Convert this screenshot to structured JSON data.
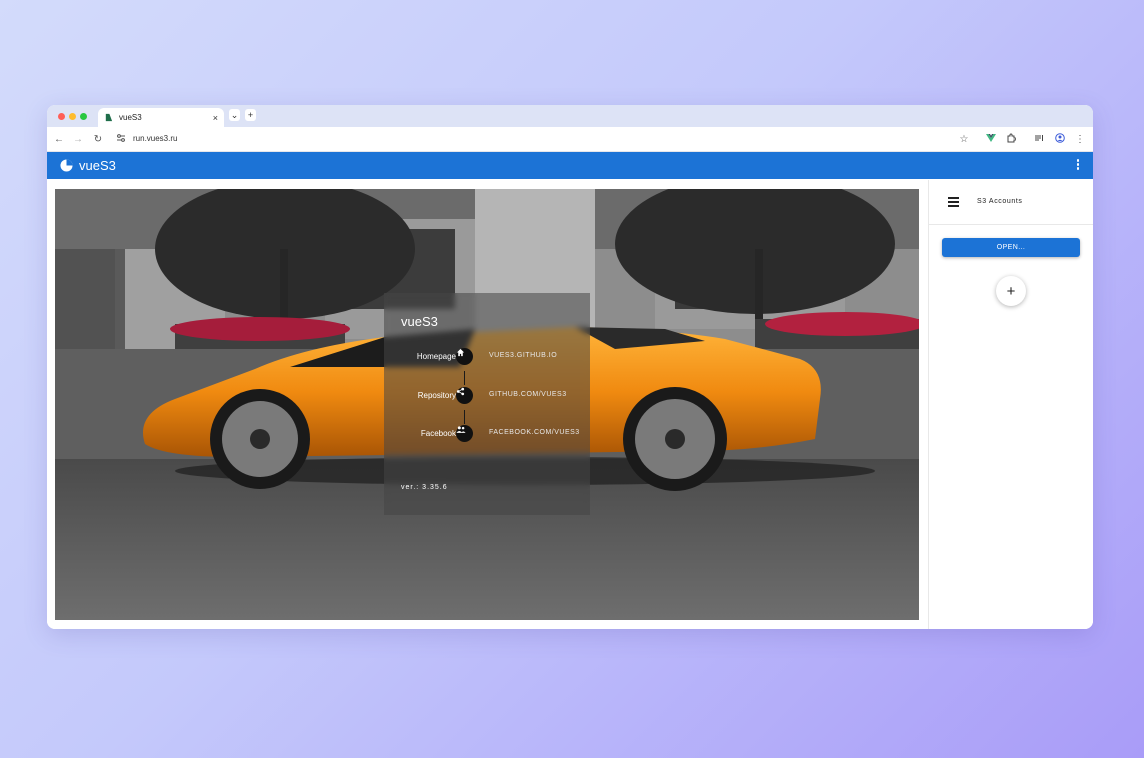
{
  "browser": {
    "tab_title": "vueS3",
    "tab_close": "×",
    "tab_list": "⌄",
    "new_tab": "+",
    "url": "run.vues3.ru"
  },
  "app": {
    "title": "vueS3",
    "brand_color": "#1c73d6"
  },
  "card": {
    "title": "vueS3",
    "links": [
      {
        "label": "Homepage",
        "link": "VUES3.GITHUB.IO",
        "icon": "home-icon"
      },
      {
        "label": "Repository",
        "link": "GITHUB.COM/VUES3",
        "icon": "share-icon"
      },
      {
        "label": "Facebook",
        "link": "FACEBOOK.COM/VUES3",
        "icon": "group-icon"
      }
    ],
    "version": "ver.: 3.35.6"
  },
  "sidebar": {
    "title": "S3 Accounts",
    "open_button": "OPEN...",
    "add_button": "+"
  }
}
